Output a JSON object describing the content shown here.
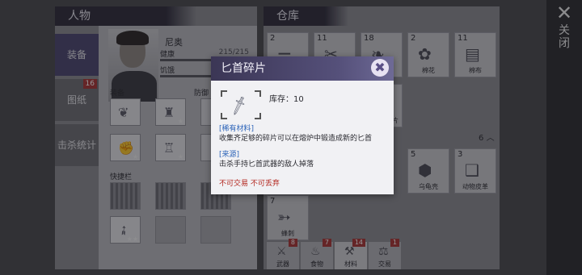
{
  "character": {
    "header": "人物",
    "tabs": [
      {
        "label": "装备"
      },
      {
        "label": "图纸",
        "badge": "16"
      },
      {
        "label": "击杀统计"
      }
    ],
    "name": "尼奥",
    "stats": {
      "health_label": "健康",
      "health_value": "215/215",
      "hunger_label": "饥饿"
    },
    "equip_label": "装备",
    "defense_label": "防御",
    "quickbar_label": "快捷栏"
  },
  "warehouse": {
    "header": "仓库",
    "items": [
      {
        "count": "2",
        "name": "",
        "icon": "bones-icon"
      },
      {
        "count": "11",
        "name": "",
        "icon": "scissors-icon"
      },
      {
        "count": "18",
        "name": "",
        "icon": "leaf-icon"
      },
      {
        "count": "2",
        "name": "棉花",
        "icon": "cotton-icon"
      },
      {
        "count": "11",
        "name": "棉布",
        "icon": "cloth-icon"
      },
      {
        "count": "5",
        "name": "乌龟壳",
        "icon": "turtle-shell-icon"
      },
      {
        "count": "3",
        "name": "动物皮革",
        "icon": "leather-icon"
      },
      {
        "count": "7",
        "name": "蜂刺",
        "icon": "stinger-icon"
      }
    ],
    "partial_label": "片",
    "collapse_count": "6",
    "bottom_tabs": [
      {
        "label": "武器",
        "badge": "8"
      },
      {
        "label": "食物",
        "badge": "7"
      },
      {
        "label": "材料",
        "badge": "14"
      },
      {
        "label": "交易",
        "badge": "1"
      }
    ]
  },
  "close": {
    "label": "关闭"
  },
  "modal": {
    "title": "匕首碎片",
    "stock": "库存：10",
    "rarity_tag": "[稀有材料]",
    "rarity_desc": "收集齐足够的碎片可以在熔炉中锻造成新的匕首",
    "source_tag": "[来源]",
    "source_desc": "击杀手持匕首武器的敌人掉落",
    "warning": "不可交易 不可丢弃"
  }
}
